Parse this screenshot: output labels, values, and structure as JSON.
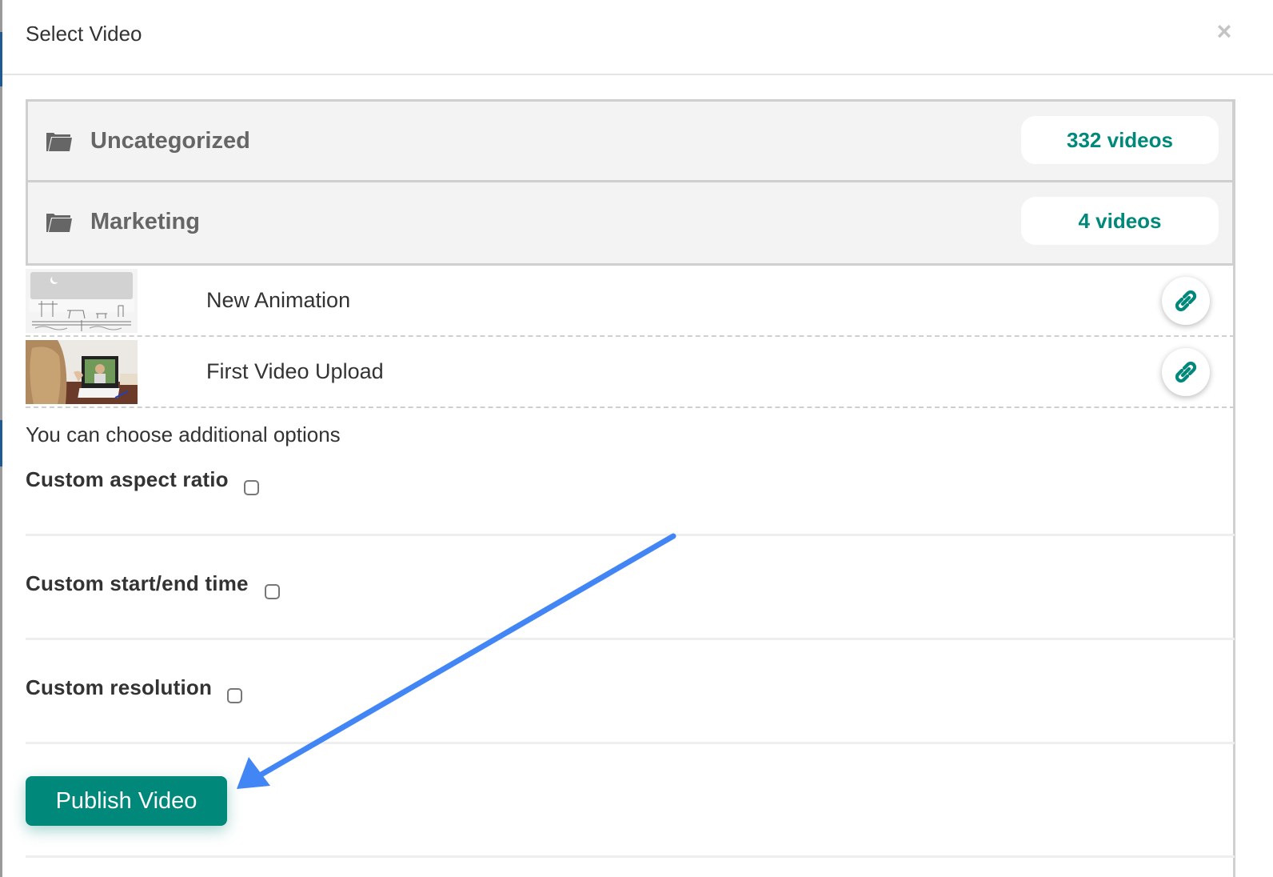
{
  "modal": {
    "title": "Select Video",
    "close_icon": "close-icon"
  },
  "categories": [
    {
      "name": "Uncategorized",
      "count_label": "332 videos",
      "icon": "folder-icon"
    },
    {
      "name": "Marketing",
      "count_label": "4 videos",
      "icon": "folder-icon"
    }
  ],
  "videos": [
    {
      "title": "New Animation",
      "thumbnail": "sketch-animals-night-scene",
      "action_icon": "link-icon"
    },
    {
      "title": "First Video Upload",
      "thumbnail": "girl-video-call-laptop",
      "action_icon": "link-icon"
    }
  ],
  "options": {
    "intro": "You can choose additional options",
    "items": [
      {
        "label": "Custom aspect ratio",
        "checked": false
      },
      {
        "label": "Custom start/end time",
        "checked": false
      },
      {
        "label": "Custom resolution",
        "checked": false
      }
    ]
  },
  "actions": {
    "publish_label": "Publish Video"
  },
  "colors": {
    "accent": "#00897b",
    "annotation_arrow": "#4285f4",
    "category_bg": "#f3f3f3",
    "category_text": "#666666"
  }
}
